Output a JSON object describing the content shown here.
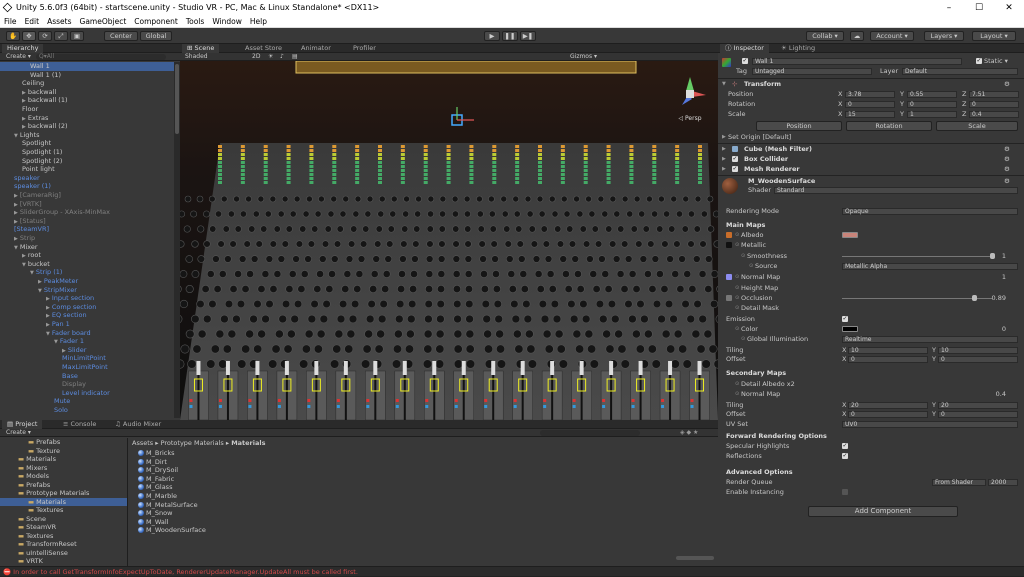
{
  "window": {
    "title": "Unity 5.6.0f3 (64bit) - startscene.unity - Studio VR - PC, Mac & Linux Standalone* <DX11>",
    "min": "–",
    "max": "☐",
    "close": "✕"
  },
  "menu": [
    "File",
    "Edit",
    "Assets",
    "GameObject",
    "Component",
    "Tools",
    "Window",
    "Help"
  ],
  "toolbar": {
    "center": "Center",
    "global": "Global",
    "collab": "Collab ▾",
    "account": "Account ▾",
    "layers": "Layers ▾",
    "layout": "Layout ▾",
    "play": "▶",
    "pause": "❚❚",
    "step": "▶❚"
  },
  "hierarchy": {
    "tab": "Hierarchy",
    "create": "Create ▾",
    "search": "Q▾All",
    "rows": [
      {
        "t": "Wall 1",
        "i": 30,
        "c": "sel",
        "tri": ""
      },
      {
        "t": "Wall 1 (1)",
        "i": 30,
        "c": "",
        "tri": ""
      },
      {
        "t": "Ceiling",
        "i": 22,
        "c": "",
        "tri": ""
      },
      {
        "t": "backwall",
        "i": 22,
        "c": "",
        "tri": "▶"
      },
      {
        "t": "backwall (1)",
        "i": 22,
        "c": "",
        "tri": "▶"
      },
      {
        "t": "Floor",
        "i": 22,
        "c": "",
        "tri": ""
      },
      {
        "t": "Extras",
        "i": 22,
        "c": "",
        "tri": "▶"
      },
      {
        "t": "backwall (2)",
        "i": 22,
        "c": "",
        "tri": "▶"
      },
      {
        "t": "Lights",
        "i": 14,
        "c": "",
        "tri": "▼"
      },
      {
        "t": "Spotlight",
        "i": 22,
        "c": "",
        "tri": ""
      },
      {
        "t": "Spotlight (1)",
        "i": 22,
        "c": "",
        "tri": ""
      },
      {
        "t": "Spotlight (2)",
        "i": 22,
        "c": "",
        "tri": ""
      },
      {
        "t": "Point light",
        "i": 22,
        "c": "",
        "tri": ""
      },
      {
        "t": "speaker",
        "i": 14,
        "c": "blue",
        "tri": ""
      },
      {
        "t": "speaker (1)",
        "i": 14,
        "c": "blue",
        "tri": ""
      },
      {
        "t": "[CameraRig]",
        "i": 14,
        "c": "gray",
        "tri": "▶"
      },
      {
        "t": "[VRTK]",
        "i": 14,
        "c": "gray",
        "tri": "▶"
      },
      {
        "t": "SliderGroup - XAxis-MinMax",
        "i": 14,
        "c": "gray",
        "tri": "▶"
      },
      {
        "t": "[Status]",
        "i": 14,
        "c": "gray",
        "tri": "▶"
      },
      {
        "t": "[SteamVR]",
        "i": 14,
        "c": "blue",
        "tri": ""
      },
      {
        "t": "Strip",
        "i": 14,
        "c": "gray",
        "tri": "▶"
      },
      {
        "t": "Mixer",
        "i": 14,
        "c": "",
        "tri": "▼"
      },
      {
        "t": "root",
        "i": 22,
        "c": "",
        "tri": "▶"
      },
      {
        "t": "bucket",
        "i": 22,
        "c": "",
        "tri": "▼"
      },
      {
        "t": "Strip (1)",
        "i": 30,
        "c": "blue",
        "tri": "▼"
      },
      {
        "t": "PeakMeter",
        "i": 38,
        "c": "blue",
        "tri": "▶"
      },
      {
        "t": "StripMixer",
        "i": 38,
        "c": "blue",
        "tri": "▼"
      },
      {
        "t": "Input section",
        "i": 46,
        "c": "blue",
        "tri": "▶"
      },
      {
        "t": "Comp section",
        "i": 46,
        "c": "blue",
        "tri": "▶"
      },
      {
        "t": "EQ section",
        "i": 46,
        "c": "blue",
        "tri": "▶"
      },
      {
        "t": "Pan 1",
        "i": 46,
        "c": "blue",
        "tri": "▶"
      },
      {
        "t": "Fader board",
        "i": 46,
        "c": "blue",
        "tri": "▼"
      },
      {
        "t": "Fader 1",
        "i": 54,
        "c": "blue",
        "tri": "▼"
      },
      {
        "t": "Slider",
        "i": 62,
        "c": "blue",
        "tri": "▶"
      },
      {
        "t": "MinLimitPoint",
        "i": 62,
        "c": "blue",
        "tri": ""
      },
      {
        "t": "MaxLimitPoint",
        "i": 62,
        "c": "blue",
        "tri": ""
      },
      {
        "t": "Base",
        "i": 62,
        "c": "blue",
        "tri": ""
      },
      {
        "t": "Display",
        "i": 62,
        "c": "gray",
        "tri": ""
      },
      {
        "t": "Level indicator",
        "i": 62,
        "c": "blue",
        "tri": ""
      },
      {
        "t": "Mute",
        "i": 54,
        "c": "blue",
        "tri": ""
      },
      {
        "t": "Solo",
        "i": 54,
        "c": "blue",
        "tri": ""
      }
    ]
  },
  "scene": {
    "tabs": [
      "Scene",
      "Asset Store",
      "Animator",
      "Profiler"
    ],
    "shaded": "Shaded",
    "twod": "2D",
    "gizmos": "Gizmos ▾",
    "persp": "◁ Persp"
  },
  "project": {
    "tabs": [
      "Project",
      "Console",
      "Audio Mixer"
    ],
    "create": "Create ▾",
    "tree": [
      {
        "t": "Prefabs",
        "i": 28
      },
      {
        "t": "Texture",
        "i": 28
      },
      {
        "t": "Materials",
        "i": 18
      },
      {
        "t": "Mixers",
        "i": 18
      },
      {
        "t": "Models",
        "i": 18
      },
      {
        "t": "Prefabs",
        "i": 18
      },
      {
        "t": "Prototype Materials",
        "i": 18
      },
      {
        "t": "Materials",
        "i": 28,
        "sel": true
      },
      {
        "t": "Textures",
        "i": 28
      },
      {
        "t": "Scene",
        "i": 18
      },
      {
        "t": "SteamVR",
        "i": 18
      },
      {
        "t": "Textures",
        "i": 18
      },
      {
        "t": "TransformReset",
        "i": 18
      },
      {
        "t": "uIntelliSense",
        "i": 18
      },
      {
        "t": "VRTK",
        "i": 18
      }
    ],
    "breadcrumb": [
      "Assets",
      "Prototype Materials",
      "Materials"
    ],
    "files": [
      "M_Bricks",
      "M_Dirt",
      "M_DrySoil",
      "M_Fabric",
      "M_Glass",
      "M_Marble",
      "M_MetalSurface",
      "M_Snow",
      "M_Wall",
      "M_WoodenSurface"
    ]
  },
  "inspector": {
    "tabs": [
      "Inspector",
      "Lighting"
    ],
    "name": "Wall 1",
    "static": "Static ▾",
    "tag_label": "Tag",
    "tag": "Untagged",
    "layer_label": "Layer",
    "layer": "Default",
    "transform": "Transform",
    "position": {
      "label": "Position",
      "x": "3.78",
      "y": "0.55",
      "z": "7.51"
    },
    "rotation": {
      "label": "Rotation",
      "x": "0",
      "y": "0",
      "z": "0"
    },
    "scale": {
      "label": "Scale",
      "x": "15",
      "y": "1",
      "z": "0.4"
    },
    "buttons": [
      "Position",
      "Rotation",
      "Scale"
    ],
    "set_origin": "Set Origin [Default]",
    "mesh_filter": "Cube (Mesh Filter)",
    "box_collider": "Box Collider",
    "mesh_renderer": "Mesh Renderer",
    "material": "M_WoodenSurface",
    "shader_label": "Shader",
    "shader": "Standard",
    "rendering_mode_label": "Rendering Mode",
    "rendering_mode": "Opaque",
    "main_maps": "Main Maps",
    "albedo": "Albedo",
    "metallic": "Metallic",
    "smoothness": "Smoothness",
    "smoothness_val": "1",
    "source": "Source",
    "source_val": "Metallic Alpha",
    "normal_map": "Normal Map",
    "normal_val": "1",
    "height_map": "Height Map",
    "occlusion": "Occlusion",
    "occlusion_val": "0.89",
    "detail_mask": "Detail Mask",
    "emission": "Emission",
    "color": "Color",
    "color_val": "0",
    "gi": "Global Illumination",
    "gi_val": "Realtime",
    "tiling": "Tiling",
    "offset": "Offset",
    "tiling_x": "10",
    "tiling_y": "10",
    "offset_x": "0",
    "offset_y": "0",
    "secondary": "Secondary Maps",
    "detail_albedo": "Detail Albedo x2",
    "normal_map2": "Normal Map",
    "normal2_val": "0.4",
    "tiling2_x": "20",
    "tiling2_y": "20",
    "offset2_x": "0",
    "offset2_y": "0",
    "uvset": "UV Set",
    "uvset_val": "UV0",
    "forward": "Forward Rendering Options",
    "specular": "Specular Highlights",
    "reflections": "Reflections",
    "advanced": "Advanced Options",
    "render_queue": "Render Queue",
    "render_queue_mode": "From Shader",
    "render_queue_val": "2000",
    "instancing": "Enable Instancing",
    "add_component": "Add Component"
  },
  "status": "In order to call GetTransformInfoExpectUpToDate, RendererUpdateManager.UpdateAll must be called first."
}
